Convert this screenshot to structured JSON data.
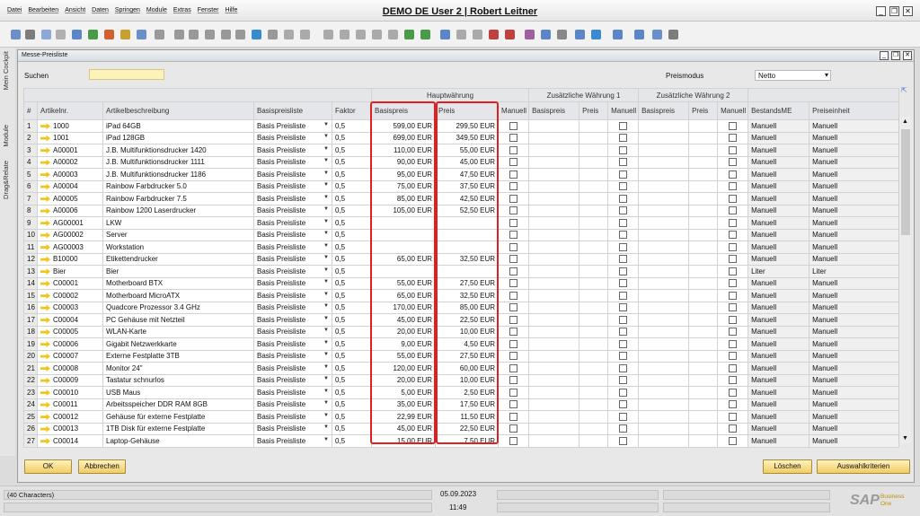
{
  "window": {
    "title": "DEMO DE User 2 | Robert Leitner"
  },
  "menu": [
    "Datei",
    "Bearbeiten",
    "Ansicht",
    "Daten",
    "Springen",
    "Module",
    "Extras",
    "Fenster",
    "Hilfe"
  ],
  "sidebar": {
    "tabs": [
      "Mein Cockpit",
      "Module",
      "Drag&Relate"
    ]
  },
  "form": {
    "title": "Messe-Preisliste",
    "search_label": "Suchen",
    "search_value": "",
    "price_mode_label": "Preismodus",
    "price_mode_value": "Netto"
  },
  "table": {
    "group_headers": {
      "main": "Hauptwährung",
      "add1": "Zusätzliche Währung 1",
      "add2": "Zusätzliche Währung 2"
    },
    "columns": [
      "#",
      "Artikelnr.",
      "Artikelbeschreibung",
      "Basispreisliste",
      "Faktor",
      "Basispreis",
      "Preis",
      "Manuell",
      "Basispreis",
      "Preis",
      "Manuell",
      "Basispreis",
      "Preis",
      "Manuell",
      "BestandsME",
      "Preiseinheit"
    ],
    "rows": [
      [
        "1",
        "1000",
        "iPad 64GB",
        "Basis Preisliste",
        "0,5",
        "599,00 EUR",
        "299,50 EUR",
        "Manuell",
        "Manuell"
      ],
      [
        "2",
        "1001",
        "iPad 128GB",
        "Basis Preisliste",
        "0,5",
        "699,00 EUR",
        "349,50 EUR",
        "Manuell",
        "Manuell"
      ],
      [
        "3",
        "A00001",
        "J.B. Multifunktionsdrucker 1420",
        "Basis Preisliste",
        "0,5",
        "110,00 EUR",
        "55,00 EUR",
        "Manuell",
        "Manuell"
      ],
      [
        "4",
        "A00002",
        "J.B. Multifunktionsdrucker 1111",
        "Basis Preisliste",
        "0,5",
        "90,00 EUR",
        "45,00 EUR",
        "Manuell",
        "Manuell"
      ],
      [
        "5",
        "A00003",
        "J.B. Multifunktionsdrucker 1186",
        "Basis Preisliste",
        "0,5",
        "95,00 EUR",
        "47,50 EUR",
        "Manuell",
        "Manuell"
      ],
      [
        "6",
        "A00004",
        "Rainbow Farbdrucker 5.0",
        "Basis Preisliste",
        "0,5",
        "75,00 EUR",
        "37,50 EUR",
        "Manuell",
        "Manuell"
      ],
      [
        "7",
        "A00005",
        "Rainbow Farbdrucker 7.5",
        "Basis Preisliste",
        "0,5",
        "85,00 EUR",
        "42,50 EUR",
        "Manuell",
        "Manuell"
      ],
      [
        "8",
        "A00006",
        "Rainbow 1200 Laserdrucker",
        "Basis Preisliste",
        "0,5",
        "105,00 EUR",
        "52,50 EUR",
        "Manuell",
        "Manuell"
      ],
      [
        "9",
        "AG00001",
        "LKW",
        "Basis Preisliste",
        "0,5",
        "",
        "",
        "Manuell",
        "Manuell"
      ],
      [
        "10",
        "AG00002",
        "Server",
        "Basis Preisliste",
        "0,5",
        "",
        "",
        "Manuell",
        "Manuell"
      ],
      [
        "11",
        "AG00003",
        "Workstation",
        "Basis Preisliste",
        "0,5",
        "",
        "",
        "Manuell",
        "Manuell"
      ],
      [
        "12",
        "B10000",
        "Etikettendrucker",
        "Basis Preisliste",
        "0,5",
        "65,00 EUR",
        "32,50 EUR",
        "Manuell",
        "Manuell"
      ],
      [
        "13",
        "Bier",
        "Bier",
        "Basis Preisliste",
        "0,5",
        "",
        "",
        "Liter",
        "Liter"
      ],
      [
        "14",
        "C00001",
        "Motherboard BTX",
        "Basis Preisliste",
        "0,5",
        "55,00 EUR",
        "27,50 EUR",
        "Manuell",
        "Manuell"
      ],
      [
        "15",
        "C00002",
        "Motherboard MicroATX",
        "Basis Preisliste",
        "0,5",
        "65,00 EUR",
        "32,50 EUR",
        "Manuell",
        "Manuell"
      ],
      [
        "16",
        "C00003",
        "Quadcore Prozessor 3.4 GHz",
        "Basis Preisliste",
        "0,5",
        "170,00 EUR",
        "85,00 EUR",
        "Manuell",
        "Manuell"
      ],
      [
        "17",
        "C00004",
        "PC Gehäuse mit Netzteil",
        "Basis Preisliste",
        "0,5",
        "45,00 EUR",
        "22,50 EUR",
        "Manuell",
        "Manuell"
      ],
      [
        "18",
        "C00005",
        "WLAN-Karte",
        "Basis Preisliste",
        "0,5",
        "20,00 EUR",
        "10,00 EUR",
        "Manuell",
        "Manuell"
      ],
      [
        "19",
        "C00006",
        "Gigabit Netzwerkkarte",
        "Basis Preisliste",
        "0,5",
        "9,00 EUR",
        "4,50 EUR",
        "Manuell",
        "Manuell"
      ],
      [
        "20",
        "C00007",
        "Externe Festplatte 3TB",
        "Basis Preisliste",
        "0,5",
        "55,00 EUR",
        "27,50 EUR",
        "Manuell",
        "Manuell"
      ],
      [
        "21",
        "C00008",
        "Monitor 24\"",
        "Basis Preisliste",
        "0,5",
        "120,00 EUR",
        "60,00 EUR",
        "Manuell",
        "Manuell"
      ],
      [
        "22",
        "C00009",
        "Tastatur schnurlos",
        "Basis Preisliste",
        "0,5",
        "20,00 EUR",
        "10,00 EUR",
        "Manuell",
        "Manuell"
      ],
      [
        "23",
        "C00010",
        "USB Maus",
        "Basis Preisliste",
        "0,5",
        "5,00 EUR",
        "2,50 EUR",
        "Manuell",
        "Manuell"
      ],
      [
        "24",
        "C00011",
        "Arbeitsspeicher DDR RAM 8GB",
        "Basis Preisliste",
        "0,5",
        "35,00 EUR",
        "17,50 EUR",
        "Manuell",
        "Manuell"
      ],
      [
        "25",
        "C00012",
        "Gehäuse für externe Festplatte",
        "Basis Preisliste",
        "0,5",
        "22,99 EUR",
        "11,50 EUR",
        "Manuell",
        "Manuell"
      ],
      [
        "26",
        "C00013",
        "1TB Disk für externe Festplatte",
        "Basis Preisliste",
        "0,5",
        "45,00 EUR",
        "22,50 EUR",
        "Manuell",
        "Manuell"
      ],
      [
        "27",
        "C00014",
        "Laptop-Gehäuse",
        "Basis Preisliste",
        "0,5",
        "15,00 EUR",
        "7,50 EUR",
        "Manuell",
        "Manuell"
      ]
    ]
  },
  "buttons": {
    "ok": "OK",
    "cancel": "Abbrechen",
    "delete": "Löschen",
    "select_criteria": "Auswahlkriterien"
  },
  "status": {
    "chars": "(40 Characters)",
    "date": "05.09.2023",
    "time": "11:49"
  },
  "brand": {
    "logo": "SAP",
    "sub": "Business One"
  },
  "colors": {
    "accent": "#f3c51c",
    "highlight": "#e02020"
  }
}
